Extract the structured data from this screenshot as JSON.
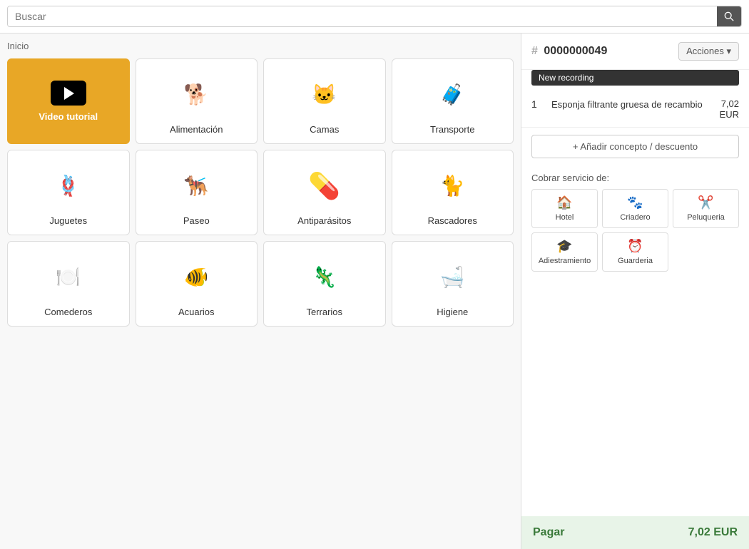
{
  "search": {
    "placeholder": "Buscar"
  },
  "breadcrumb": "Inicio",
  "categories": [
    {
      "id": "video-tutorial",
      "label": "Video tutorial",
      "type": "video"
    },
    {
      "id": "alimentacion",
      "label": "Alimentación",
      "type": "regular",
      "emoji": "🐕"
    },
    {
      "id": "camas",
      "label": "Camas",
      "type": "regular",
      "emoji": "🐱"
    },
    {
      "id": "transporte",
      "label": "Transporte",
      "type": "regular",
      "emoji": "🧳"
    },
    {
      "id": "juguetes",
      "label": "Juguetes",
      "type": "regular",
      "emoji": "🪢"
    },
    {
      "id": "paseo",
      "label": "Paseo",
      "type": "regular",
      "emoji": "🐕‍🦺"
    },
    {
      "id": "antiparasitos",
      "label": "Antiparásitos",
      "type": "regular",
      "emoji": "💊"
    },
    {
      "id": "rascadores",
      "label": "Rascadores",
      "type": "regular",
      "emoji": "🐈"
    },
    {
      "id": "comederos",
      "label": "Comederos",
      "type": "regular",
      "emoji": "🍽️"
    },
    {
      "id": "acuarios",
      "label": "Acuarios",
      "type": "regular",
      "emoji": "🐠"
    },
    {
      "id": "terrarios",
      "label": "Terrarios",
      "type": "regular",
      "emoji": "🦎"
    },
    {
      "id": "higiene",
      "label": "Higiene",
      "type": "regular",
      "emoji": "🛁"
    }
  ],
  "order": {
    "number": "0000000049",
    "acciones_label": "Acciones",
    "new_recording_label": "New recording",
    "items": [
      {
        "qty": 1,
        "name": "Esponja filtrante gruesa de recambio",
        "price": "7,02\nEUR"
      }
    ],
    "add_concept_label": "+ Añadir concepto / descuento",
    "cobrar_label": "Cobrar servicio de:",
    "services": [
      {
        "id": "hotel",
        "label": "Hotel",
        "icon": "🏠"
      },
      {
        "id": "criadero",
        "label": "Criadero",
        "icon": "🐾"
      },
      {
        "id": "peluqueria",
        "label": "Peluqueria",
        "icon": "✂️"
      }
    ],
    "services2": [
      {
        "id": "adiestramiento",
        "label": "Adiestramiento",
        "icon": "🎓"
      },
      {
        "id": "guarderia",
        "label": "Guarderia",
        "icon": "⏰"
      }
    ],
    "pay_label": "Pagar",
    "pay_amount": "7,02 EUR"
  }
}
